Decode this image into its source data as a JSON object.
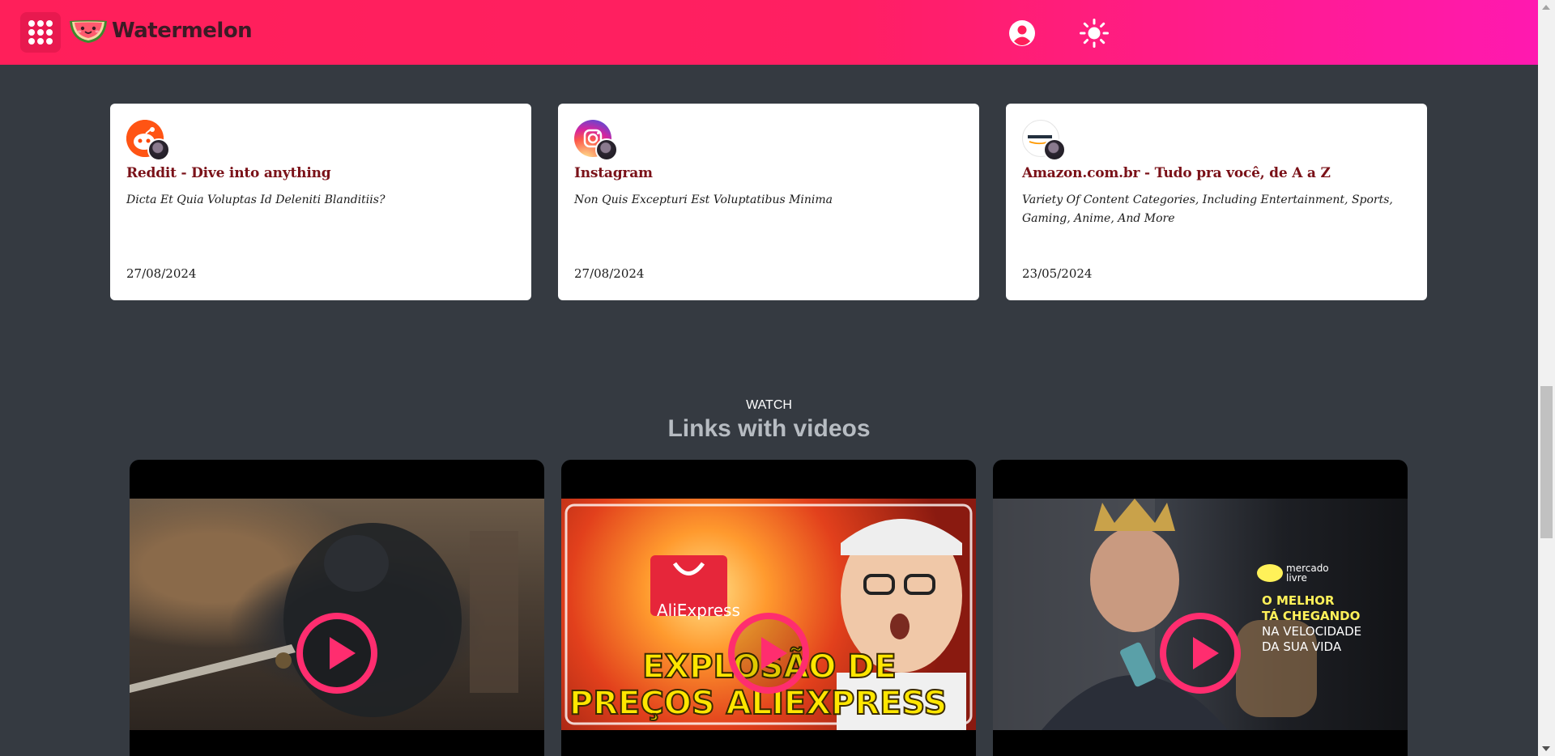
{
  "header": {
    "brand": "Watermelon",
    "apps_icon": "grid-icon",
    "user_icon": "user-circle-icon",
    "theme_icon": "sun-icon"
  },
  "links": [
    {
      "title": "Reddit - Dive into anything",
      "description": "Dicta Et Quia Voluptas Id Deleniti Blanditiis?",
      "date": "27/08/2024",
      "icon": "reddit-icon"
    },
    {
      "title": "Instagram",
      "description": "Non Quis Excepturi Est Voluptatibus Minima",
      "date": "27/08/2024",
      "icon": "instagram-icon"
    },
    {
      "title": "Amazon.com.br - Tudo pra você, de A a Z",
      "description": "Variety Of Content Categories, Including Entertainment, Sports, Gaming, Anime, And More",
      "date": "23/05/2024",
      "icon": "amazon-icon"
    }
  ],
  "videos_section": {
    "eyebrow": "WATCH",
    "title": "Links with videos"
  },
  "videos": [
    {
      "thumbnail": "armored-panther-warrior",
      "overlay_lines": []
    },
    {
      "thumbnail": "aliexpress-promo",
      "logo_text": "AliExpress",
      "overlay_lines": [
        "EXPLOSÃO DE",
        "PREÇOS ALIEXPRESS"
      ]
    },
    {
      "thumbnail": "mercado-livre-ad",
      "logo_text": "mercado livre",
      "overlay_lines": [
        "O MELHOR",
        "TÁ CHEGANDO",
        "NA VELOCIDADE",
        "DA SUA VIDA"
      ]
    }
  ],
  "colors": {
    "header_start": "#ff1f5a",
    "header_end": "#ff19b0",
    "background": "#353a41",
    "title_red": "#7a1118",
    "play_pink": "#ff2d6f"
  }
}
